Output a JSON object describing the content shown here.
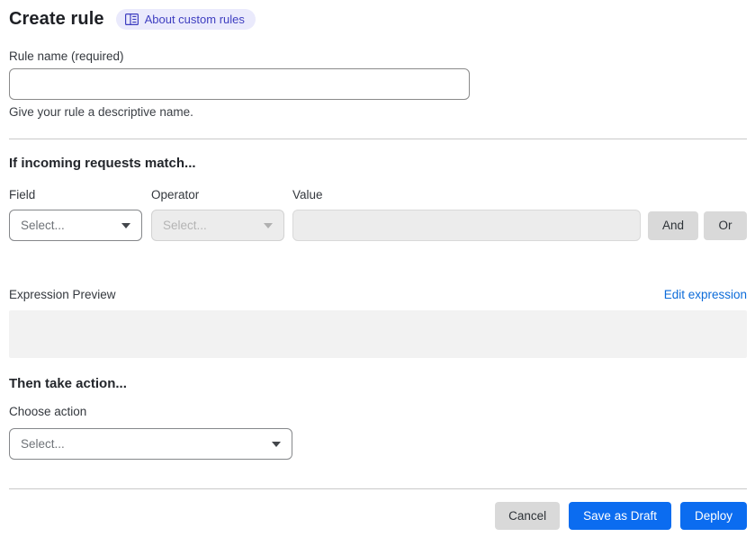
{
  "header": {
    "title": "Create rule",
    "badge": {
      "label": "About custom rules",
      "icon": "book-icon"
    }
  },
  "rule_name": {
    "label": "Rule name (required)",
    "value": "",
    "helper": "Give your rule a descriptive name."
  },
  "match_section": {
    "heading": "If incoming requests match...",
    "field": {
      "label": "Field",
      "selected": "Select..."
    },
    "operator": {
      "label": "Operator",
      "selected": "Select...",
      "disabled": true
    },
    "value": {
      "label": "Value",
      "value": "",
      "disabled": true
    },
    "and_button": "And",
    "or_button": "Or"
  },
  "expression": {
    "label": "Expression Preview",
    "edit_link": "Edit expression",
    "content": ""
  },
  "action_section": {
    "heading": "Then take action...",
    "choose_label": "Choose action",
    "selected": "Select..."
  },
  "footer": {
    "cancel": "Cancel",
    "save_draft": "Save as Draft",
    "deploy": "Deploy"
  },
  "colors": {
    "primary_blue": "#0b6cf0",
    "link_blue": "#0b6bd9",
    "badge_bg": "#eaeafc",
    "badge_text": "#3e3ec0",
    "neutral_button_bg": "#d9d9d9",
    "disabled_bg": "#ececec",
    "preview_bg": "#f2f2f2",
    "divider": "#c9c9c9"
  }
}
